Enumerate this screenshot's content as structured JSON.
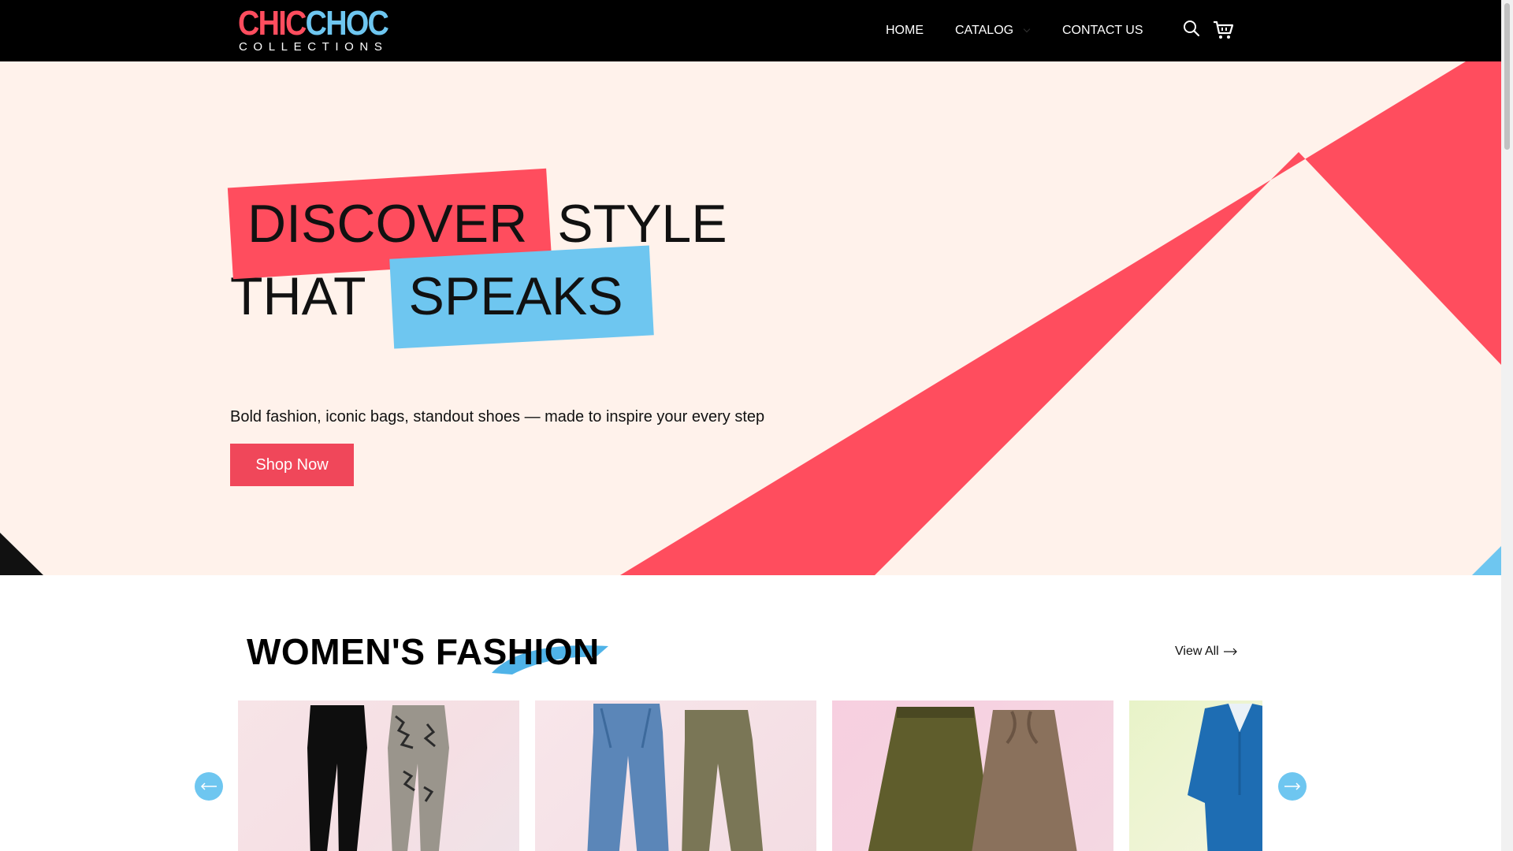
{
  "brand": {
    "logo_word_1": "CHIC",
    "logo_word_2": "CHOC",
    "logo_subtitle": "COLLECTIONS",
    "colors": {
      "red": "#ff4d5e",
      "blue": "#6ec6f0",
      "header_bg": "#000000",
      "hero_bg": "#fff2eb"
    }
  },
  "nav": {
    "home": "HOME",
    "catalog": "CATALOG",
    "contact": "CONTACT US",
    "icons": [
      "search-icon",
      "cart-icon"
    ]
  },
  "hero": {
    "title_highlight_1": "DISCOVER",
    "title_word_2": "STYLE",
    "title_word_3": "THAT",
    "title_highlight_2": "SPEAKS",
    "subtitle": "Bold fashion, iconic bags, standout shoes — made to inspire your every step",
    "cta": "Shop Now"
  },
  "womens_section": {
    "title": "WOMEN'S FASHION",
    "view_all": "View All",
    "products": [
      {
        "image": "leggings-black-and-snakeskin"
      },
      {
        "image": "flare-jeans-and-olive-pants"
      },
      {
        "image": "olive-and-taupe-maxi-skirts"
      },
      {
        "image": "blue-skirt-suit"
      }
    ],
    "carousel_icons": [
      "arrow-left-icon",
      "arrow-right-icon"
    ]
  }
}
